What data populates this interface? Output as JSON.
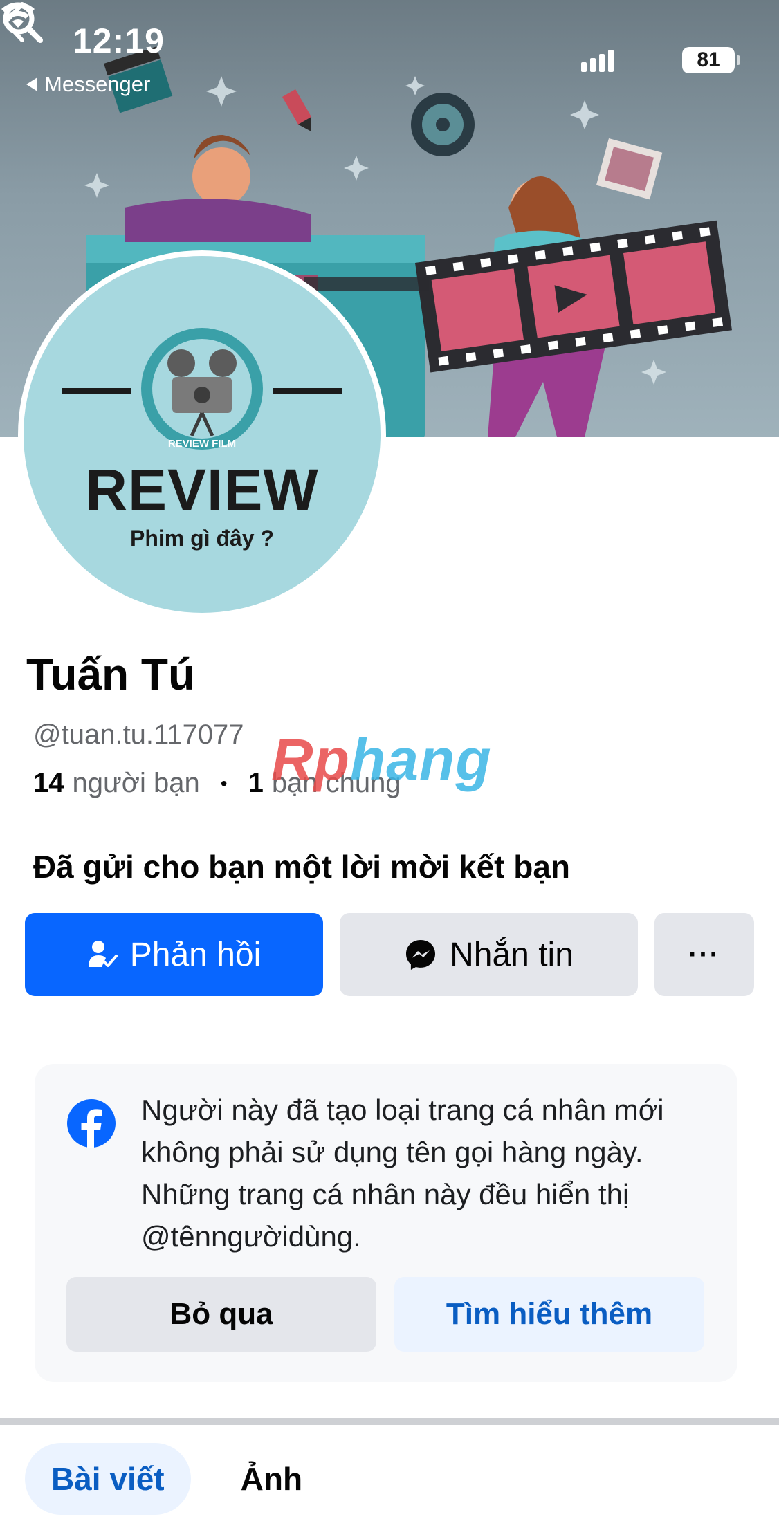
{
  "status_bar": {
    "time": "12:19",
    "back_app": "Messenger",
    "battery": "81"
  },
  "header": {
    "back_icon": "chevron-left-icon",
    "search_icon": "search-icon"
  },
  "avatar": {
    "headline": "REVIEW",
    "subline": "Phim gì đây ?",
    "ring_text": "REVIEW FILM"
  },
  "profile": {
    "name": "Tuấn Tú",
    "handle": "@tuan.tu.117077",
    "friends_count": "14",
    "friends_label": "người bạn",
    "mutual_count": "1",
    "mutual_label": "bạn chung",
    "separator": "•"
  },
  "watermark": {
    "part1": "Rp",
    "part2": "hang"
  },
  "friend_request": {
    "message": "Đã gửi cho bạn một lời mời kết bạn"
  },
  "actions": {
    "respond_label": "Phản hồi",
    "message_label": "Nhắn tin",
    "more_label": "···"
  },
  "notice": {
    "text": "Người này đã tạo loại trang cá nhân mới không phải sử dụng tên gọi hàng ngày. Những trang cá nhân này đều hiển thị @tênngườidùng.",
    "dismiss_label": "Bỏ qua",
    "learn_more_label": "Tìm hiểu thêm"
  },
  "tabs": [
    {
      "label": "Bài viết",
      "active": true
    },
    {
      "label": "Ảnh",
      "active": false
    }
  ],
  "colors": {
    "primary": "#0866ff",
    "gray_button": "#e4e6eb",
    "light_blue": "#ebf3ff"
  }
}
